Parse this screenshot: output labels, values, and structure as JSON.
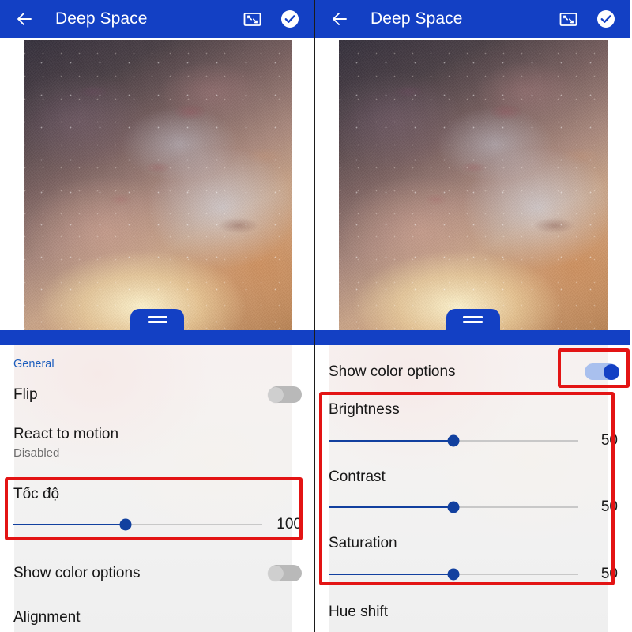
{
  "app": {
    "title": "Deep Space",
    "accent_blue": "#1340c4",
    "annotation_red": "#e31414",
    "link_blue": "#1e5fbe"
  },
  "appbar": {
    "back_icon": "arrow-left-icon",
    "title": "Deep Space",
    "fit_icon": "fit-to-screen-icon",
    "confirm_icon": "check-circle-icon"
  },
  "preview": {
    "name": "wallpaper-preview",
    "alt": "Deep space galaxy image"
  },
  "drag_handle": {
    "name": "sheet-drag-handle"
  },
  "left_panel": {
    "section_title": "General",
    "rows": [
      {
        "label": "Flip",
        "type": "toggle",
        "state": "off"
      },
      {
        "label": "React to motion",
        "sub": "Disabled",
        "type": "text"
      },
      {
        "label": "Tốc độ",
        "type": "slider",
        "value": "100",
        "percent": 45,
        "highlighted": true
      },
      {
        "label": "Show color options",
        "type": "toggle",
        "state": "off"
      },
      {
        "label": "Alignment",
        "type": "text"
      }
    ]
  },
  "right_panel": {
    "rows": [
      {
        "label": "Show color options",
        "type": "toggle",
        "state": "on",
        "highlighted": true
      },
      {
        "label": "Brightness",
        "type": "slider",
        "value": "50",
        "percent": 50
      },
      {
        "label": "Contrast",
        "type": "slider",
        "value": "50",
        "percent": 50
      },
      {
        "label": "Saturation",
        "type": "slider",
        "value": "50",
        "percent": 50
      },
      {
        "label": "Hue shift",
        "type": "text"
      }
    ]
  }
}
